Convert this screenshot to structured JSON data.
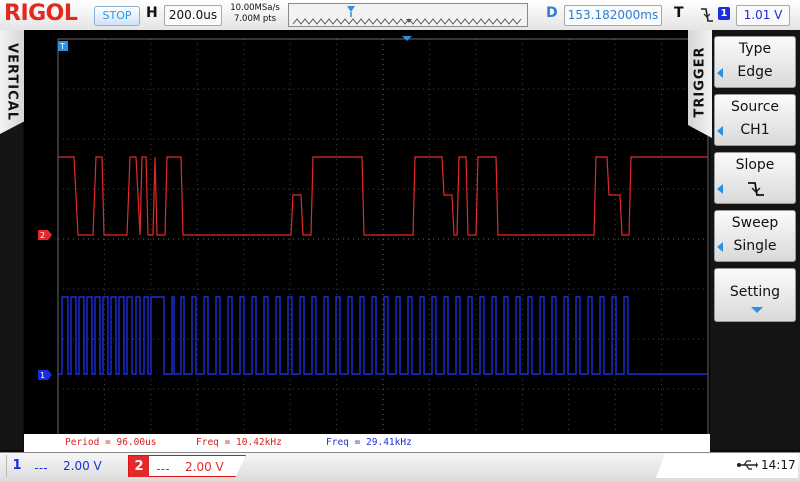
{
  "header": {
    "brand": "RIGOL",
    "run_state": "STOP",
    "horizontal_letter": "H",
    "timebase": "200.0us",
    "sample_rate": "10.00MSa/s",
    "memory_depth": "7.00M pts",
    "delay_letter": "D",
    "delay": "153.182000ms",
    "trigger_letter": "T",
    "trigger_source_badge": "1",
    "trigger_level": "1.01 V"
  },
  "left_panel": {
    "tab_label": "VERTICAL"
  },
  "trigger_menu": {
    "tab_label": "TRIGGER",
    "items": [
      {
        "title": "Type",
        "value": "Edge"
      },
      {
        "title": "Source",
        "value": "CH1"
      },
      {
        "title": "Slope",
        "value": "",
        "icon": "falling-edge-icon"
      },
      {
        "title": "Sweep",
        "value": "Single"
      },
      {
        "title": "Setting",
        "value": "",
        "icon": "chevron-down-icon"
      }
    ]
  },
  "measurements": [
    {
      "text": "Period = 96.00us",
      "color": "#e02020"
    },
    {
      "text": "Freq = 10.42kHz",
      "color": "#e02020"
    },
    {
      "text": "Freq = 29.41kHz",
      "color": "#2230d6"
    }
  ],
  "channels": [
    {
      "number": "1",
      "scale": "2.00 V",
      "color": "#1a2ddc",
      "marker": "1"
    },
    {
      "number": "2",
      "scale": "2.00 V",
      "color": "#e32a2a",
      "marker": "2"
    }
  ],
  "status": {
    "clock": "14:17",
    "usb_icon": "usb-icon"
  },
  "colors": {
    "brand": "#e3281e",
    "accent": "#2e8fe0",
    "ch1": "#1a2ddc",
    "ch2": "#e32a2a"
  }
}
